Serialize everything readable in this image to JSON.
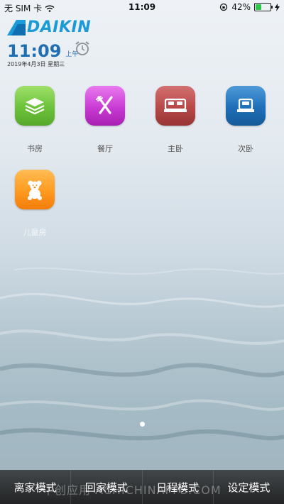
{
  "status_bar": {
    "carrier": "无 SIM 卡",
    "time": "11:09",
    "battery_percent": "42%",
    "battery_level": 0.42
  },
  "brand": {
    "logo_text": "DAIKIN"
  },
  "clock": {
    "time": "11:09",
    "ampm": "上午",
    "date": "2019年4月3日 星期三"
  },
  "rooms": [
    {
      "label": "书房",
      "icon": "stack-layers-icon",
      "color": "#6cc23a"
    },
    {
      "label": "餐厅",
      "icon": "fork-knife-icon",
      "color": "#c93bd3"
    },
    {
      "label": "主卧",
      "icon": "double-bed-icon",
      "color": "#b84949"
    },
    {
      "label": "次卧",
      "icon": "single-bed-icon",
      "color": "#1f6fb8"
    },
    {
      "label": "儿童房",
      "icon": "teddy-bear-icon",
      "color": "#ff9a1f"
    }
  ],
  "pager": {
    "current_page": 1,
    "total_pages": 1
  },
  "modes": [
    {
      "label": "离家模式"
    },
    {
      "label": "回家模式"
    },
    {
      "label": "日程模式"
    },
    {
      "label": "设定模式"
    }
  ],
  "watermark": "中创应用 ACHICHINAPPS.COM"
}
